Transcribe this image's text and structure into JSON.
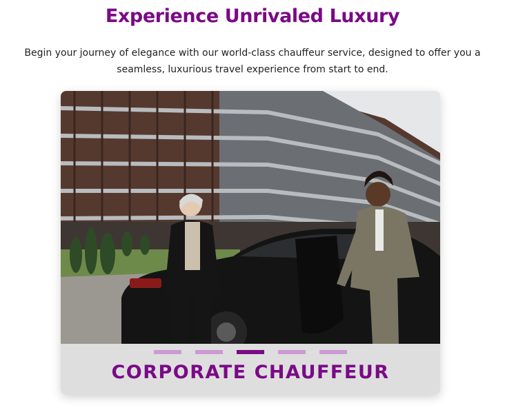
{
  "hero": {
    "title": "Experience Unrivaled Luxury",
    "subtitle": "Begin your journey of elegance with our world-class chauffeur service, designed to offer you a seamless, luxurious travel experience from start to end."
  },
  "carousel": {
    "slide_caption": "CORPORATE CHAUFFEUR",
    "slide_image": "corporate-chauffeur-photo",
    "slide_count": 5,
    "active_index": 2
  },
  "colors": {
    "accent": "#7a0a86",
    "indicator_inactive": "#cc9ad3",
    "caption_panel": "#dedede",
    "body_text": "#222222"
  }
}
